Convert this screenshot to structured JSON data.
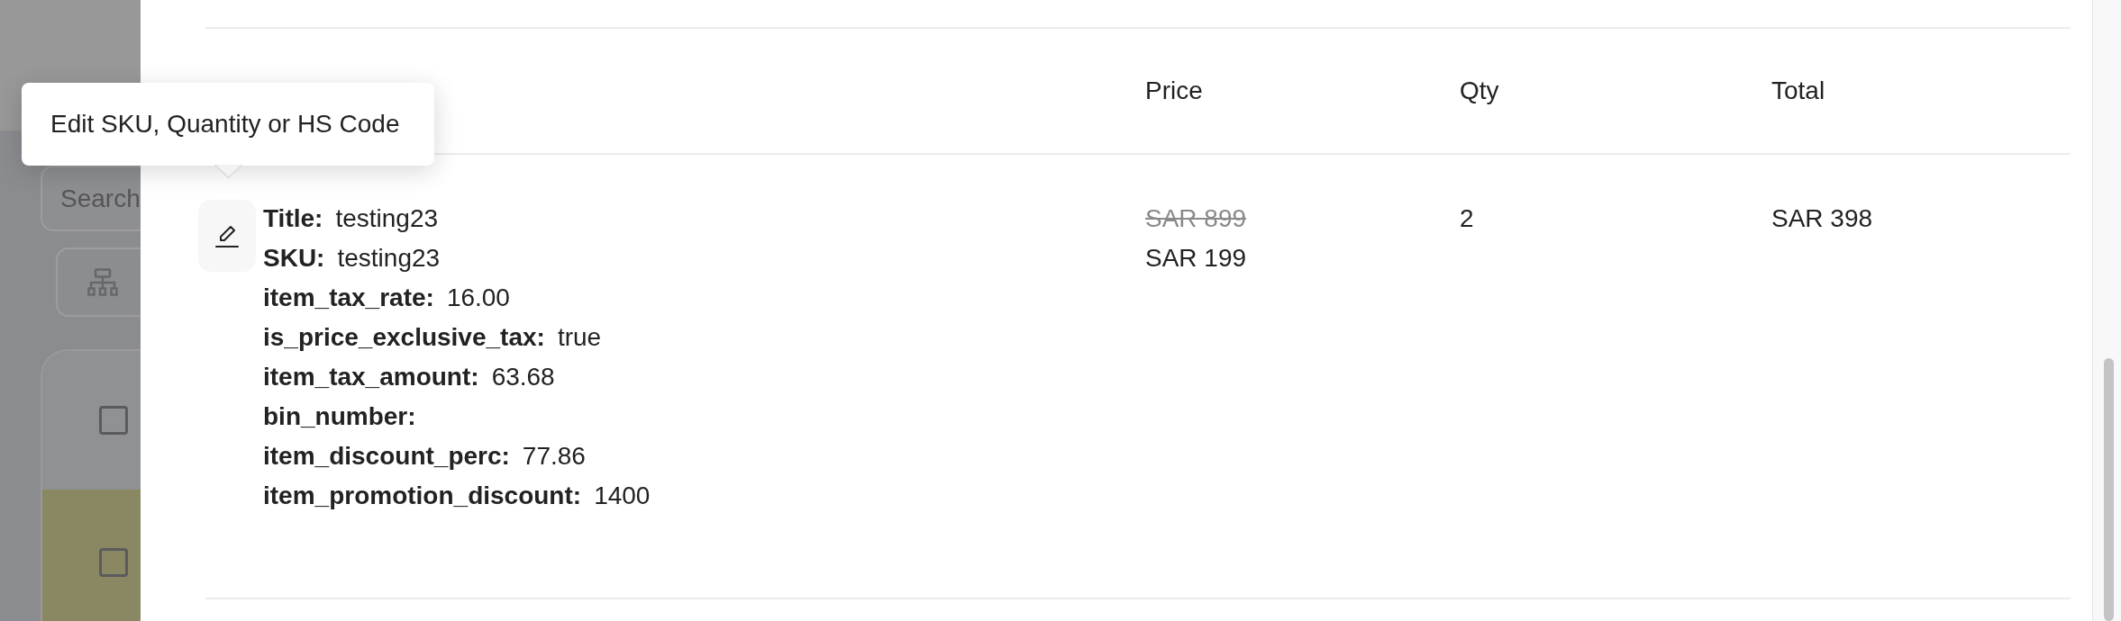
{
  "background_page": {
    "search": {
      "placeholder": "Search"
    },
    "rows": [
      {
        "checked": false,
        "highlighted": false
      },
      {
        "checked": false,
        "highlighted": true
      }
    ]
  },
  "tooltip": {
    "text": "Edit SKU, Quantity or HS Code"
  },
  "items_table": {
    "columns": [
      {
        "label": "Price"
      },
      {
        "label": "Qty"
      },
      {
        "label": "Total"
      }
    ],
    "rows": [
      {
        "attributes": [
          {
            "label": "Title:",
            "value": "testing23"
          },
          {
            "label": "SKU:",
            "value": "testing23"
          },
          {
            "label": "item_tax_rate:",
            "value": "16.00"
          },
          {
            "label": "is_price_exclusive_tax:",
            "value": "true"
          },
          {
            "label": "item_tax_amount:",
            "value": "63.68"
          },
          {
            "label": "bin_number:"
          },
          {
            "label": "item_discount_perc:",
            "value": "77.86"
          },
          {
            "label": "item_promotion_discount:",
            "value": "1400"
          }
        ],
        "original_price": "SAR 899",
        "price": "SAR 199",
        "qty": "2",
        "total": "SAR 398"
      }
    ]
  }
}
